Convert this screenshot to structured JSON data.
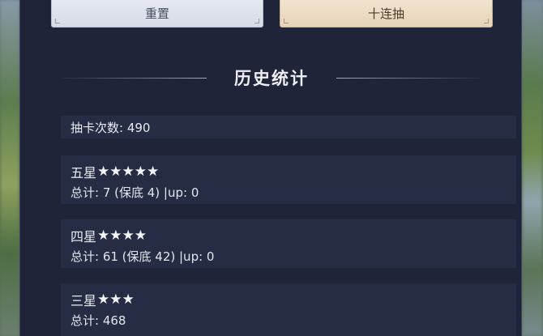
{
  "buttons": {
    "reset_label": "重置",
    "ten_pull_label": "十连抽"
  },
  "history": {
    "title": "历史统计",
    "total_pulls_label": "抽卡次数: 490",
    "five_star": {
      "label": "五星",
      "stars": "★★★★★",
      "summary": "总计: 7 (保底 4) |up: 0"
    },
    "four_star": {
      "label": "四星",
      "stars": "★★★★",
      "summary": "总计: 61 (保底 42) |up: 0"
    },
    "three_star": {
      "label": "三星",
      "stars": "★★★",
      "summary": "总计: 468"
    }
  },
  "colors": {
    "panel_bg": "#1f2438",
    "box_bg": "#262c43",
    "reset_button_bg": "#e2e6ee",
    "ten_pull_button_bg": "#eeddc4"
  }
}
